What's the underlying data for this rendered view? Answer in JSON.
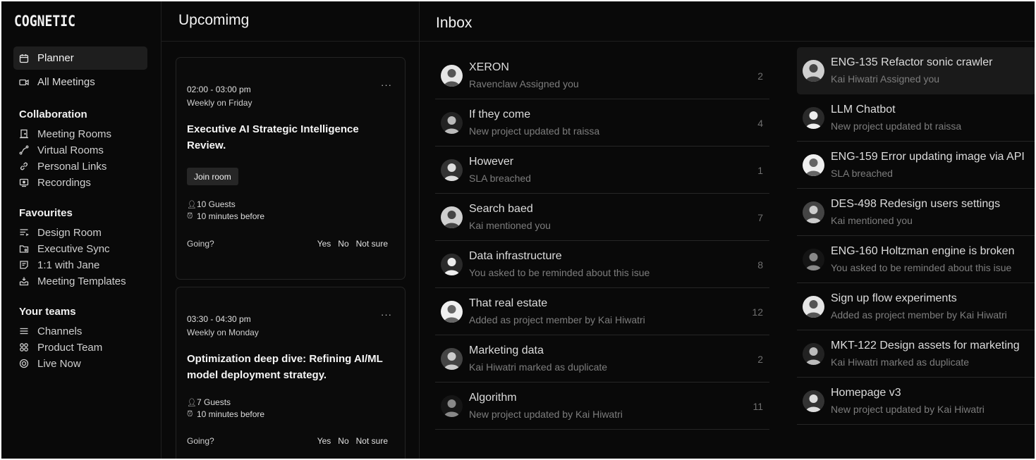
{
  "app": {
    "logo": "COGNETIC"
  },
  "sidebar": {
    "main": [
      {
        "label": "Planner",
        "icon": "calendar-icon"
      },
      {
        "label": "All Meetings",
        "icon": "video-icon"
      }
    ],
    "collaboration_title": "Collaboration",
    "collaboration": [
      {
        "label": "Meeting Rooms",
        "icon": "door-icon"
      },
      {
        "label": "Virtual Rooms",
        "icon": "path-icon"
      },
      {
        "label": "Personal Links",
        "icon": "link-icon"
      },
      {
        "label": "Recordings",
        "icon": "recording-icon"
      }
    ],
    "favourites_title": "Favourites",
    "favourites": [
      {
        "label": "Design Room",
        "icon": "list-icon"
      },
      {
        "label": "Executive Sync",
        "icon": "folder-icon"
      },
      {
        "label": "1:1 with Jane",
        "icon": "note-icon"
      },
      {
        "label": "Meeting Templates",
        "icon": "tray-icon"
      }
    ],
    "teams_title": "Your teams",
    "teams": [
      {
        "label": "Channels",
        "icon": "menu-icon"
      },
      {
        "label": "Product Team",
        "icon": "grid-icon"
      },
      {
        "label": "Live Now",
        "icon": "live-icon"
      }
    ]
  },
  "upcoming": {
    "title": "Upcomimg",
    "more": "···",
    "cards": [
      {
        "time": "02:00 - 03:00 pm",
        "recurrence": "Weekly on Friday",
        "title": "Executive AI Strategic Intelligence Review.",
        "join_label": "Join room",
        "guests": "10 Guests",
        "reminder": "10 minutes before",
        "going_label": "Going?",
        "yes": "Yes",
        "no": "No",
        "not_sure": "Not sure"
      },
      {
        "time": "03:30 - 04:30 pm",
        "recurrence": "Weekly on Monday",
        "title": "Optimization deep dive: Refining AI/ML model deployment strategy.",
        "guests": "7 Guests",
        "reminder": "10 minutes before",
        "going_label": "Going?",
        "yes": "Yes",
        "no": "No",
        "not_sure": "Not sure"
      }
    ]
  },
  "inbox": {
    "title": "Inbox",
    "left": [
      {
        "name": "XERON",
        "sub": "Ravenclaw Assigned you",
        "count": "2"
      },
      {
        "name": "If they come",
        "sub": "New project updated bt raissa",
        "count": "4"
      },
      {
        "name": "However",
        "sub": "SLA breached",
        "count": "1"
      },
      {
        "name": "Search baed",
        "sub": "Kai mentioned you",
        "count": "7"
      },
      {
        "name": "Data infrastructure",
        "sub": "You asked to be reminded about this isue",
        "count": "8"
      },
      {
        "name": "That real estate",
        "sub": "Added as project member by Kai Hiwatri",
        "count": "12"
      },
      {
        "name": "Marketing data",
        "sub": "Kai Hiwatri marked as duplicate",
        "count": "2"
      },
      {
        "name": "Algorithm",
        "sub": "New project updated by Kai Hiwatri",
        "count": "11"
      }
    ],
    "right": [
      {
        "name": "ENG-135 Refactor sonic crawler",
        "sub": "Kai Hiwatri Assigned you"
      },
      {
        "name": "LLM Chatbot",
        "sub": "New project updated bt raissa"
      },
      {
        "name": "ENG-159 Error updating image via API",
        "sub": "SLA breached"
      },
      {
        "name": "DES-498 Redesign users settings",
        "sub": "Kai mentioned you"
      },
      {
        "name": "ENG-160 Holtzman engine is broken",
        "sub": "You asked to be reminded about this isue"
      },
      {
        "name": "Sign up flow experiments",
        "sub": "Added as project member by Kai Hiwatri"
      },
      {
        "name": "MKT-122 Design assets for marketing",
        "sub": "Kai Hiwatri marked as duplicate"
      },
      {
        "name": "Homepage v3",
        "sub": "New project updated by Kai Hiwatri"
      }
    ]
  }
}
